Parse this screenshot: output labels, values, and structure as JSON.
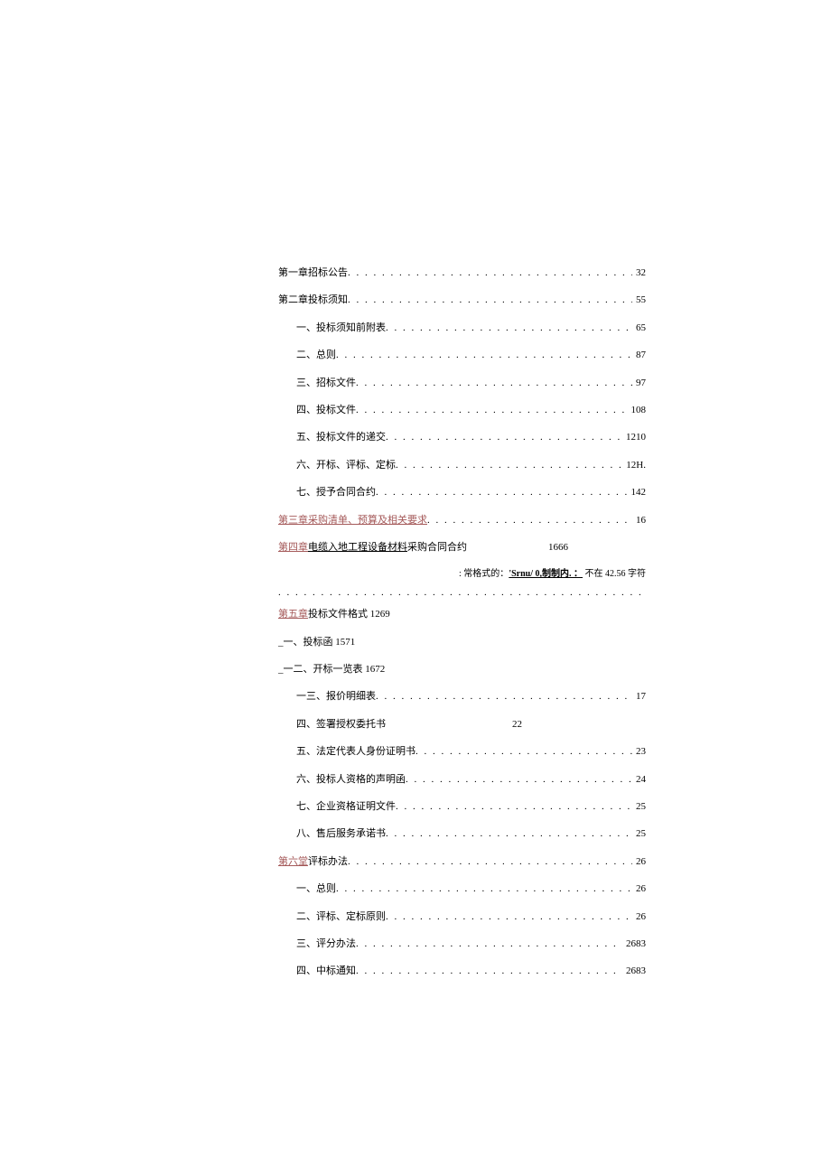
{
  "note": {
    "prefix": ": 常格式的：",
    "code": "'Srnu/ 0,制制内. ：",
    "tail": "不在 42.56 字符"
  },
  "toc": [
    {
      "kind": "dotted",
      "indent": false,
      "link": false,
      "label": "第一章招标公告",
      "page": "32"
    },
    {
      "kind": "dotted",
      "indent": false,
      "link": false,
      "label": "第二章投标须知",
      "page": "55"
    },
    {
      "kind": "dotted",
      "indent": true,
      "link": false,
      "label": "一、投标须知前附表",
      "page": "65"
    },
    {
      "kind": "dotted",
      "indent": true,
      "link": false,
      "label": "二、总则",
      "page": "87"
    },
    {
      "kind": "dotted",
      "indent": true,
      "link": false,
      "label": "三、招标文件",
      "page": "97"
    },
    {
      "kind": "dotted",
      "indent": true,
      "link": false,
      "label": "四、投标文件",
      "page": "108"
    },
    {
      "kind": "dotted",
      "indent": true,
      "link": false,
      "label": "五、投标文件的递交",
      "page": "1210"
    },
    {
      "kind": "dotted",
      "indent": true,
      "link": false,
      "label": "六、开标、评标、定标",
      "page": "12H."
    },
    {
      "kind": "dotted",
      "indent": true,
      "link": false,
      "label": "七、授予合同合约",
      "page": "142"
    },
    {
      "kind": "dotted",
      "indent": false,
      "link": true,
      "label": "第三章采购清单、预算及相关要求",
      "page": "16"
    },
    {
      "kind": "plain-4",
      "indent": false,
      "link_part": "第四章",
      "rest": "电缆入地工程设备材料",
      "tail": "采购合同合约",
      "page": "1666"
    },
    {
      "kind": "note"
    },
    {
      "kind": "dotrow"
    },
    {
      "kind": "plain",
      "indent": false,
      "link_part": "第五章",
      "rest": "投标文件格式 1269"
    },
    {
      "kind": "plain",
      "indent": false,
      "link_part": "",
      "rest": "_一、投标函 1571"
    },
    {
      "kind": "plain",
      "indent": false,
      "link_part": "",
      "rest": "_一二、开标一览表 1672"
    },
    {
      "kind": "dotted",
      "indent": true,
      "link": false,
      "label": "一三、报价明细表",
      "page": "17"
    },
    {
      "kind": "plain-gap",
      "indent": true,
      "label": "四、签署授权委托书",
      "page": "22"
    },
    {
      "kind": "dotted",
      "indent": true,
      "link": false,
      "label": "五、法定代表人身份证明书",
      "page": "23"
    },
    {
      "kind": "dotted",
      "indent": true,
      "link": false,
      "label": "六、投标人资格的声明函",
      "page": "24"
    },
    {
      "kind": "dotted",
      "indent": true,
      "link": false,
      "label": "七、企业资格证明文件",
      "page": "25"
    },
    {
      "kind": "dotted",
      "indent": true,
      "link": false,
      "label": "八、售后服务承诺书",
      "page": "25"
    },
    {
      "kind": "dotted-6",
      "indent": false,
      "link_part": "第六堂",
      "rest": "评标办法",
      "page": "26"
    },
    {
      "kind": "dotted",
      "indent": true,
      "link": false,
      "label": "一、总则",
      "page": "26"
    },
    {
      "kind": "dotted",
      "indent": true,
      "link": false,
      "label": "二、评标、定标原则",
      "page": "26"
    },
    {
      "kind": "dotted",
      "indent": true,
      "link": false,
      "label": "三、评分办法",
      "page": "2683"
    },
    {
      "kind": "dotted",
      "indent": true,
      "link": false,
      "label": "四、中标通知",
      "page": "2683"
    }
  ]
}
